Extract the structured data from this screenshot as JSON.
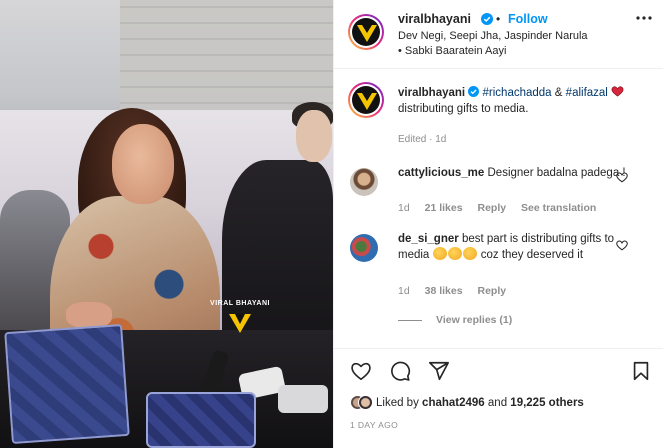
{
  "post": {
    "username": "viralbhayani",
    "follow_label": "Follow",
    "dot_separator": "•",
    "audio_line": "Dev Negi, Seepi Jha, Jaspinder Narula • Sabki Baaratein Aayi",
    "watermark_text": "VIRAL BHAYANI",
    "caption": {
      "username": "viralbhayani",
      "tag1": "#richachadda",
      "amp": "&",
      "tag2": "#alifazal",
      "text": "distributing gifts to media.",
      "meta": "Edited · 1d"
    },
    "comments": [
      {
        "username": "cattylicious_me",
        "text": "Designer badalna padega !",
        "time": "1d",
        "likes": "21 likes",
        "reply": "Reply",
        "translate": "See translation"
      },
      {
        "username": "de_si_gner",
        "text_before": "best part is distributing gifts to media",
        "text_after": "coz they deserved it",
        "time": "1d",
        "likes": "38 likes",
        "reply": "Reply"
      }
    ],
    "view_replies": "View replies (1)",
    "liked_by_prefix": "Liked by",
    "liked_by_user": "chahat2496",
    "liked_by_and": "and",
    "liked_by_count": "19,225 others",
    "timestamp": "1 DAY AGO"
  },
  "colors": {
    "link_blue": "#0095f6",
    "hashtag": "#00376b",
    "muted": "#8e8e8e",
    "verified": "#0095f6",
    "heart_red": "#ed4956"
  },
  "icons": [
    "verified-badge-icon",
    "more-options-icon",
    "heart-icon",
    "comment-icon",
    "share-icon",
    "bookmark-icon"
  ]
}
